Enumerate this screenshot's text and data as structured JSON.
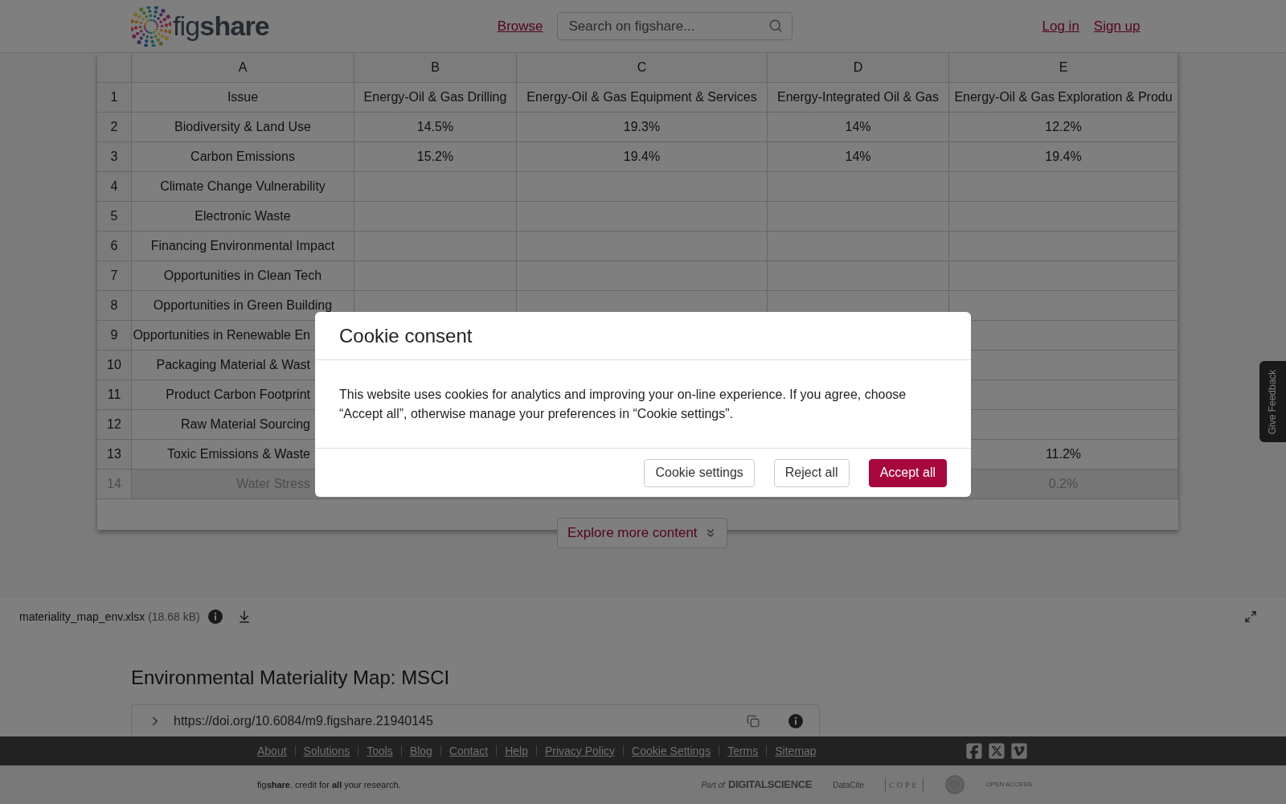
{
  "header": {
    "logo": "fig**share**",
    "nav_link": "Browse",
    "search": {
      "placeholder": "Search on figshare..."
    },
    "auth_links": [
      "Log in",
      "Sign up"
    ]
  },
  "sheet": {
    "columns": [
      "A",
      "B",
      "C",
      "D",
      "E"
    ],
    "rows": [
      {
        "number": "1",
        "covered": false,
        "faded": false,
        "cells": [
          "Issue",
          "Energy-Oil & Gas Drilling",
          "Energy-Oil & Gas Equipment & Services",
          "Energy-Integrated Oil & Gas",
          "Energy-Oil & Gas Exploration & Produ"
        ]
      },
      {
        "number": "2",
        "covered": false,
        "faded": false,
        "cells": [
          "Biodiversity & Land Use",
          "14.5%",
          "19.3%",
          "14%",
          "12.2%"
        ]
      },
      {
        "number": "3",
        "covered": false,
        "faded": false,
        "cells": [
          "Carbon Emissions",
          "15.2%",
          "19.4%",
          "14%",
          "19.4%"
        ]
      },
      {
        "number": "4",
        "covered": false,
        "faded": false,
        "cells": [
          "Climate Change Vulnerability",
          null,
          null,
          null,
          null
        ]
      },
      {
        "number": "5",
        "covered": false,
        "faded": false,
        "cells": [
          "Electronic Waste",
          null,
          null,
          null,
          null
        ]
      },
      {
        "number": "6",
        "covered": false,
        "faded": false,
        "cells": [
          "Financing Environmental Impact",
          null,
          null,
          null,
          null
        ]
      },
      {
        "number": "7",
        "covered": false,
        "faded": false,
        "cells": [
          "Opportunities in Clean Tech",
          null,
          null,
          null,
          null
        ]
      },
      {
        "number": "8",
        "covered": false,
        "faded": false,
        "cells": [
          "Opportunities in Green Building",
          null,
          null,
          null,
          null
        ]
      },
      {
        "number": "9",
        "covered": true,
        "faded": false,
        "cells": [
          "Opportunities in Renewable En",
          null,
          null,
          null,
          null
        ]
      },
      {
        "number": "10",
        "covered": true,
        "faded": false,
        "cells": [
          "Packaging Material & Wast",
          null,
          null,
          null,
          null
        ]
      },
      {
        "number": "11",
        "covered": true,
        "faded": false,
        "cells": [
          "Product Carbon Footprint",
          null,
          null,
          null,
          null
        ]
      },
      {
        "number": "12",
        "covered": true,
        "faded": false,
        "cells": [
          "Raw Material Sourcing",
          null,
          null,
          null,
          null
        ]
      },
      {
        "number": "13",
        "covered": true,
        "faded": false,
        "cells": [
          "Toxic Emissions & Waste",
          null,
          null,
          null,
          "11.2%"
        ]
      },
      {
        "number": "14",
        "covered": true,
        "faded": true,
        "cells": [
          "Water Stress",
          null,
          null,
          null,
          "0.2%"
        ]
      }
    ]
  },
  "explore_button": "Explore more content",
  "file": {
    "name": "materiality_map_env.xlsx",
    "size": "(18.68 kB)"
  },
  "title": "Environmental Materiality Map: MSCI",
  "doi": "https://doi.org/10.6084/m9.figshare.21940145",
  "feedback": "Give Feedback",
  "footer": {
    "links": [
      "About",
      "Solutions",
      "Tools",
      "Blog",
      "Contact",
      "Help",
      "Privacy Policy",
      "Cookie Settings",
      "Terms",
      "Sitemap"
    ],
    "tagline": "fig**share**. credit for **all** your research.",
    "partners": [
      {
        "kind": "digital_science",
        "prefix": "Part of",
        "name": "DIGITALSCIENCE"
      },
      {
        "kind": "datacite",
        "name": "DataCite"
      },
      {
        "kind": "cope",
        "name": "COPE"
      },
      {
        "kind": "seal"
      },
      {
        "kind": "open_access",
        "name": "OPEN ACCESS"
      }
    ]
  },
  "dialog": {
    "title": "Cookie consent",
    "body": "This website uses cookies for analytics and improving your on-line experience. If you agree, choose “Accept all”, otherwise manage your preferences in “Cookie settings”.",
    "buttons": [
      {
        "label": "Cookie settings",
        "kind": "secondary"
      },
      {
        "label": "Reject all",
        "kind": "secondary"
      },
      {
        "label": "Accept all",
        "kind": "primary"
      }
    ]
  }
}
